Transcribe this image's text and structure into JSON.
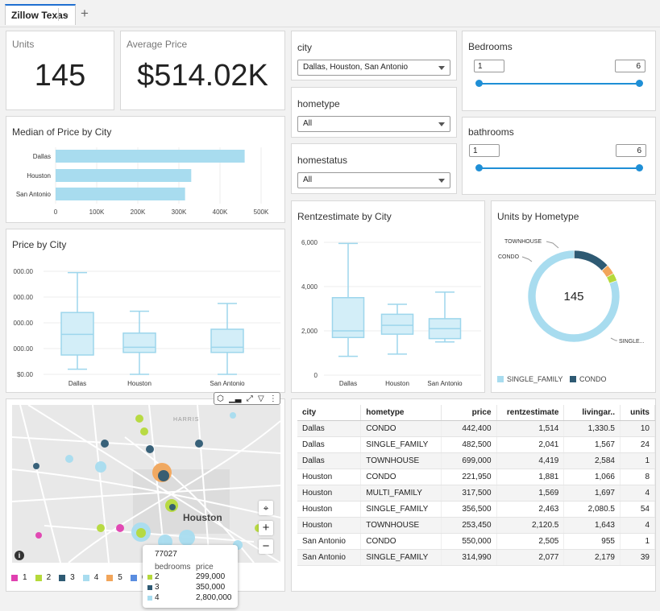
{
  "tab": {
    "label": "Zillow Texas"
  },
  "kpi": {
    "units": {
      "label": "Units",
      "value": "145"
    },
    "avg_price": {
      "label": "Average Price",
      "value": "$514.02K"
    }
  },
  "filters": {
    "city": {
      "label": "city",
      "value": "Dallas, Houston, San Antonio"
    },
    "hometype": {
      "label": "hometype",
      "value": "All"
    },
    "homestatus": {
      "label": "homestatus",
      "value": "All"
    },
    "bedrooms": {
      "label": "Bedrooms",
      "min": "1",
      "max": "6"
    },
    "bathrooms": {
      "label": "bathrooms",
      "min": "1",
      "max": "6"
    }
  },
  "charts": {
    "median_title": "Median of Price by City",
    "price_title": "Price by City",
    "rent_title": "Rentzestimate by City",
    "donut_title": "Units by Hometype"
  },
  "chart_data": [
    {
      "type": "bar",
      "title": "Median of Price by City",
      "orientation": "horizontal",
      "categories": [
        "Dallas",
        "Houston",
        "San Antonio"
      ],
      "values": [
        460000,
        330000,
        315000
      ],
      "x_ticks": [
        "0",
        "100K",
        "200K",
        "300K",
        "400K",
        "500K"
      ],
      "xlim": [
        0,
        500000
      ],
      "color": "#a8dcef"
    },
    {
      "type": "box",
      "title": "Price by City",
      "categories": [
        "Dallas",
        "Houston",
        "San Antonio"
      ],
      "y_ticks": [
        "$0.00",
        "000.00",
        "000.00",
        "000.00",
        "000.00"
      ],
      "ylim": [
        0,
        4
      ],
      "boxes": [
        {
          "min": 0.2,
          "q1": 0.75,
          "median": 1.55,
          "q3": 2.4,
          "max": 3.95
        },
        {
          "min": 0.0,
          "q1": 0.85,
          "median": 1.05,
          "q3": 1.6,
          "max": 2.45
        },
        {
          "min": 0.0,
          "q1": 0.85,
          "median": 1.05,
          "q3": 1.75,
          "max": 2.75
        }
      ],
      "color": "#a8dcef"
    },
    {
      "type": "box",
      "title": "Rentzestimate by City",
      "categories": [
        "Dallas",
        "Houston",
        "San Antonio"
      ],
      "y_ticks": [
        "0",
        "2,000",
        "4,000",
        "6,000"
      ],
      "ylim": [
        0,
        6000
      ],
      "boxes": [
        {
          "min": 850,
          "q1": 1700,
          "median": 2000,
          "q3": 3500,
          "max": 5950
        },
        {
          "min": 950,
          "q1": 1850,
          "median": 2250,
          "q3": 2750,
          "max": 3200
        },
        {
          "min": 1500,
          "q1": 1650,
          "median": 2100,
          "q3": 2550,
          "max": 3750
        }
      ],
      "color": "#a8dcef"
    },
    {
      "type": "pie",
      "title": "Units by Hometype",
      "center_label": "145",
      "labels": [
        "SINGLE_FAMILY",
        "CONDO",
        "TOWNHOUSE",
        "MULTI_FAMILY"
      ],
      "values": [
        117,
        19,
        5,
        4
      ],
      "slice_labels": [
        "SINGLE...",
        "CONDO",
        "TOWNHOUSE"
      ],
      "colors": [
        "#a8dcef",
        "#2e5a73",
        "#f2a55a",
        "#b5d93a"
      ],
      "legend": [
        "SINGLE_FAMILY",
        "CONDO"
      ]
    }
  ],
  "table": {
    "headers": [
      "city",
      "hometype",
      "price",
      "rentzestimate",
      "livingar..",
      "units"
    ],
    "rows": [
      [
        "Dallas",
        "CONDO",
        "442,400",
        "1,514",
        "1,330.5",
        "10"
      ],
      [
        "Dallas",
        "SINGLE_FAMILY",
        "482,500",
        "2,041",
        "1,567",
        "24"
      ],
      [
        "Dallas",
        "TOWNHOUSE",
        "699,000",
        "4,419",
        "2,584",
        "1"
      ],
      [
        "Houston",
        "CONDO",
        "221,950",
        "1,881",
        "1,066",
        "8"
      ],
      [
        "Houston",
        "MULTI_FAMILY",
        "317,500",
        "1,569",
        "1,697",
        "4"
      ],
      [
        "Houston",
        "SINGLE_FAMILY",
        "356,500",
        "2,463",
        "2,080.5",
        "54"
      ],
      [
        "Houston",
        "TOWNHOUSE",
        "253,450",
        "2,120.5",
        "1,643",
        "4"
      ],
      [
        "San Antonio",
        "CONDO",
        "550,000",
        "2,505",
        "955",
        "1"
      ],
      [
        "San Antonio",
        "SINGLE_FAMILY",
        "314,990",
        "2,077",
        "2,179",
        "39"
      ]
    ]
  },
  "map": {
    "labels": {
      "city": "Houston",
      "county": "HARRIS"
    },
    "tooltip": {
      "title": "77027",
      "col1": "bedrooms",
      "col2": "price",
      "rows": [
        {
          "bedrooms": "2",
          "price": "299,000",
          "color": "#b5d93a"
        },
        {
          "bedrooms": "3",
          "price": "350,000",
          "color": "#2e5a73"
        },
        {
          "bedrooms": "4",
          "price": "2,800,000",
          "color": "#a8dcef"
        }
      ]
    },
    "legend": [
      {
        "label": "1",
        "color": "#e040b0"
      },
      {
        "label": "2",
        "color": "#b5d93a"
      },
      {
        "label": "3",
        "color": "#2e5a73"
      },
      {
        "label": "4",
        "color": "#a8dcef"
      },
      {
        "label": "5",
        "color": "#f2a55a"
      },
      {
        "label": "6",
        "color": "#5a8de0"
      }
    ],
    "icons": [
      "focus-icon",
      "zoom-in-icon",
      "zoom-out-icon",
      "info-icon"
    ]
  }
}
